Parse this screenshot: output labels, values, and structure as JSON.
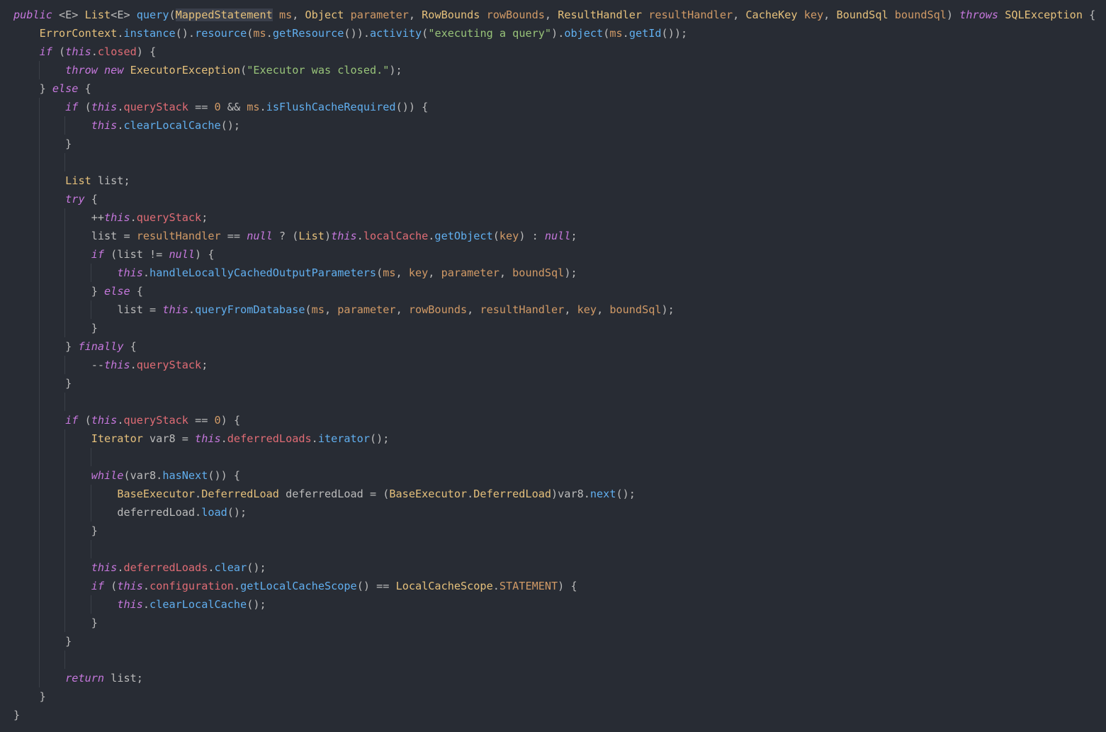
{
  "editor": {
    "language": "java",
    "theme_colors": {
      "background": "#282c34",
      "keyword": "#c678dd",
      "type": "#e5c07b",
      "function": "#61afef",
      "field": "#e06c75",
      "parameter": "#d19a66",
      "string": "#98c379",
      "number": "#d19a66",
      "plain": "#bbbbbb"
    },
    "lines": [
      {
        "indent": 0,
        "tokens": [
          [
            "kw",
            "public"
          ],
          [
            "p",
            " <E> "
          ],
          [
            "type",
            "List"
          ],
          [
            "p",
            "<E> "
          ],
          [
            "fn",
            "query"
          ],
          [
            "p",
            "("
          ],
          [
            "type_hl",
            "MappedStatement"
          ],
          [
            "p",
            " "
          ],
          [
            "param",
            "ms"
          ],
          [
            "p",
            ", "
          ],
          [
            "type",
            "Object"
          ],
          [
            "p",
            " "
          ],
          [
            "param",
            "parameter"
          ],
          [
            "p",
            ", "
          ],
          [
            "type",
            "RowBounds"
          ],
          [
            "p",
            " "
          ],
          [
            "param",
            "rowBounds"
          ],
          [
            "p",
            ", "
          ],
          [
            "type",
            "ResultHandler"
          ],
          [
            "p",
            " "
          ],
          [
            "param",
            "resultHandler"
          ],
          [
            "p",
            ", "
          ],
          [
            "type",
            "CacheKey"
          ],
          [
            "p",
            " "
          ],
          [
            "param",
            "key"
          ],
          [
            "p",
            ", "
          ],
          [
            "type",
            "BoundSql"
          ],
          [
            "p",
            " "
          ],
          [
            "param",
            "boundSql"
          ],
          [
            "p",
            ") "
          ],
          [
            "kw",
            "throws"
          ],
          [
            "p",
            " "
          ],
          [
            "type",
            "SQLException"
          ],
          [
            "p",
            " {"
          ]
        ]
      },
      {
        "indent": 1,
        "tokens": [
          [
            "type",
            "ErrorContext"
          ],
          [
            "p",
            "."
          ],
          [
            "fn",
            "instance"
          ],
          [
            "p",
            "()."
          ],
          [
            "fn",
            "resource"
          ],
          [
            "p",
            "("
          ],
          [
            "param",
            "ms"
          ],
          [
            "p",
            "."
          ],
          [
            "fn",
            "getResource"
          ],
          [
            "p",
            "())."
          ],
          [
            "fn",
            "activity"
          ],
          [
            "p",
            "("
          ],
          [
            "str",
            "\"executing a query\""
          ],
          [
            "p",
            ")."
          ],
          [
            "fn",
            "object"
          ],
          [
            "p",
            "("
          ],
          [
            "param",
            "ms"
          ],
          [
            "p",
            "."
          ],
          [
            "fn",
            "getId"
          ],
          [
            "p",
            "());"
          ]
        ]
      },
      {
        "indent": 1,
        "tokens": [
          [
            "kw",
            "if"
          ],
          [
            "p",
            " ("
          ],
          [
            "kw",
            "this"
          ],
          [
            "p",
            "."
          ],
          [
            "fld",
            "closed"
          ],
          [
            "p",
            ") {"
          ]
        ]
      },
      {
        "indent": 2,
        "tokens": [
          [
            "kw",
            "throw"
          ],
          [
            "p",
            " "
          ],
          [
            "kw",
            "new"
          ],
          [
            "p",
            " "
          ],
          [
            "type",
            "ExecutorException"
          ],
          [
            "p",
            "("
          ],
          [
            "str",
            "\"Executor was closed.\""
          ],
          [
            "p",
            ");"
          ]
        ]
      },
      {
        "indent": 1,
        "tokens": [
          [
            "p",
            "} "
          ],
          [
            "kw",
            "else"
          ],
          [
            "p",
            " {"
          ]
        ]
      },
      {
        "indent": 2,
        "tokens": [
          [
            "kw",
            "if"
          ],
          [
            "p",
            " ("
          ],
          [
            "kw",
            "this"
          ],
          [
            "p",
            "."
          ],
          [
            "fld",
            "queryStack"
          ],
          [
            "p",
            " == "
          ],
          [
            "num",
            "0"
          ],
          [
            "p",
            " && "
          ],
          [
            "param",
            "ms"
          ],
          [
            "p",
            "."
          ],
          [
            "fn",
            "isFlushCacheRequired"
          ],
          [
            "p",
            "()) {"
          ]
        ]
      },
      {
        "indent": 3,
        "tokens": [
          [
            "kw",
            "this"
          ],
          [
            "p",
            "."
          ],
          [
            "fn",
            "clearLocalCache"
          ],
          [
            "p",
            "();"
          ]
        ]
      },
      {
        "indent": 2,
        "tokens": [
          [
            "p",
            "}"
          ]
        ]
      },
      {
        "indent": 0,
        "tokens": []
      },
      {
        "indent": 2,
        "tokens": [
          [
            "type",
            "List"
          ],
          [
            "p",
            " list;"
          ]
        ]
      },
      {
        "indent": 2,
        "tokens": [
          [
            "kw",
            "try"
          ],
          [
            "p",
            " {"
          ]
        ]
      },
      {
        "indent": 3,
        "tokens": [
          [
            "p",
            "++"
          ],
          [
            "kw",
            "this"
          ],
          [
            "p",
            "."
          ],
          [
            "fld",
            "queryStack"
          ],
          [
            "p",
            ";"
          ]
        ]
      },
      {
        "indent": 3,
        "tokens": [
          [
            "p",
            "list = "
          ],
          [
            "param",
            "resultHandler"
          ],
          [
            "p",
            " == "
          ],
          [
            "kw",
            "null"
          ],
          [
            "p",
            " ? ("
          ],
          [
            "type",
            "List"
          ],
          [
            "p",
            ")"
          ],
          [
            "kw",
            "this"
          ],
          [
            "p",
            "."
          ],
          [
            "fld",
            "localCache"
          ],
          [
            "p",
            "."
          ],
          [
            "fn",
            "getObject"
          ],
          [
            "p",
            "("
          ],
          [
            "param",
            "key"
          ],
          [
            "p",
            ") : "
          ],
          [
            "kw",
            "null"
          ],
          [
            "p",
            ";"
          ]
        ]
      },
      {
        "indent": 3,
        "tokens": [
          [
            "kw",
            "if"
          ],
          [
            "p",
            " (list != "
          ],
          [
            "kw",
            "null"
          ],
          [
            "p",
            ") {"
          ]
        ]
      },
      {
        "indent": 4,
        "tokens": [
          [
            "kw",
            "this"
          ],
          [
            "p",
            "."
          ],
          [
            "fn",
            "handleLocallyCachedOutputParameters"
          ],
          [
            "p",
            "("
          ],
          [
            "param",
            "ms"
          ],
          [
            "p",
            ", "
          ],
          [
            "param",
            "key"
          ],
          [
            "p",
            ", "
          ],
          [
            "param",
            "parameter"
          ],
          [
            "p",
            ", "
          ],
          [
            "param",
            "boundSql"
          ],
          [
            "p",
            ");"
          ]
        ]
      },
      {
        "indent": 3,
        "tokens": [
          [
            "p",
            "} "
          ],
          [
            "kw",
            "else"
          ],
          [
            "p",
            " {"
          ]
        ]
      },
      {
        "indent": 4,
        "tokens": [
          [
            "p",
            "list = "
          ],
          [
            "kw",
            "this"
          ],
          [
            "p",
            "."
          ],
          [
            "fn",
            "queryFromDatabase"
          ],
          [
            "p",
            "("
          ],
          [
            "param",
            "ms"
          ],
          [
            "p",
            ", "
          ],
          [
            "param",
            "parameter"
          ],
          [
            "p",
            ", "
          ],
          [
            "param",
            "rowBounds"
          ],
          [
            "p",
            ", "
          ],
          [
            "param",
            "resultHandler"
          ],
          [
            "p",
            ", "
          ],
          [
            "param",
            "key"
          ],
          [
            "p",
            ", "
          ],
          [
            "param",
            "boundSql"
          ],
          [
            "p",
            ");"
          ]
        ]
      },
      {
        "indent": 3,
        "tokens": [
          [
            "p",
            "}"
          ]
        ]
      },
      {
        "indent": 2,
        "tokens": [
          [
            "p",
            "} "
          ],
          [
            "kw",
            "finally"
          ],
          [
            "p",
            " {"
          ]
        ]
      },
      {
        "indent": 3,
        "tokens": [
          [
            "p",
            "--"
          ],
          [
            "kw",
            "this"
          ],
          [
            "p",
            "."
          ],
          [
            "fld",
            "queryStack"
          ],
          [
            "p",
            ";"
          ]
        ]
      },
      {
        "indent": 2,
        "tokens": [
          [
            "p",
            "}"
          ]
        ]
      },
      {
        "indent": 0,
        "tokens": []
      },
      {
        "indent": 2,
        "tokens": [
          [
            "kw",
            "if"
          ],
          [
            "p",
            " ("
          ],
          [
            "kw",
            "this"
          ],
          [
            "p",
            "."
          ],
          [
            "fld",
            "queryStack"
          ],
          [
            "p",
            " == "
          ],
          [
            "num",
            "0"
          ],
          [
            "p",
            ") {"
          ]
        ]
      },
      {
        "indent": 3,
        "tokens": [
          [
            "type",
            "Iterator"
          ],
          [
            "p",
            " var8 = "
          ],
          [
            "kw",
            "this"
          ],
          [
            "p",
            "."
          ],
          [
            "fld",
            "deferredLoads"
          ],
          [
            "p",
            "."
          ],
          [
            "fn",
            "iterator"
          ],
          [
            "p",
            "();"
          ]
        ]
      },
      {
        "indent": 0,
        "tokens": []
      },
      {
        "indent": 3,
        "tokens": [
          [
            "kw",
            "while"
          ],
          [
            "p",
            "(var8."
          ],
          [
            "fn",
            "hasNext"
          ],
          [
            "p",
            "()) {"
          ]
        ]
      },
      {
        "indent": 4,
        "tokens": [
          [
            "type",
            "BaseExecutor"
          ],
          [
            "p",
            "."
          ],
          [
            "type",
            "DeferredLoad"
          ],
          [
            "p",
            " deferredLoad = ("
          ],
          [
            "type",
            "BaseExecutor"
          ],
          [
            "p",
            "."
          ],
          [
            "type",
            "DeferredLoad"
          ],
          [
            "p",
            ")var8."
          ],
          [
            "fn",
            "next"
          ],
          [
            "p",
            "();"
          ]
        ]
      },
      {
        "indent": 4,
        "tokens": [
          [
            "p",
            "deferredLoad."
          ],
          [
            "fn",
            "load"
          ],
          [
            "p",
            "();"
          ]
        ]
      },
      {
        "indent": 3,
        "tokens": [
          [
            "p",
            "}"
          ]
        ]
      },
      {
        "indent": 0,
        "tokens": []
      },
      {
        "indent": 3,
        "tokens": [
          [
            "kw",
            "this"
          ],
          [
            "p",
            "."
          ],
          [
            "fld",
            "deferredLoads"
          ],
          [
            "p",
            "."
          ],
          [
            "fn",
            "clear"
          ],
          [
            "p",
            "();"
          ]
        ]
      },
      {
        "indent": 3,
        "tokens": [
          [
            "kw",
            "if"
          ],
          [
            "p",
            " ("
          ],
          [
            "kw",
            "this"
          ],
          [
            "p",
            "."
          ],
          [
            "fld",
            "configuration"
          ],
          [
            "p",
            "."
          ],
          [
            "fn",
            "getLocalCacheScope"
          ],
          [
            "p",
            "() == "
          ],
          [
            "type",
            "LocalCacheScope"
          ],
          [
            "p",
            "."
          ],
          [
            "const",
            "STATEMENT"
          ],
          [
            "p",
            ") {"
          ]
        ]
      },
      {
        "indent": 4,
        "tokens": [
          [
            "kw",
            "this"
          ],
          [
            "p",
            "."
          ],
          [
            "fn",
            "clearLocalCache"
          ],
          [
            "p",
            "();"
          ]
        ]
      },
      {
        "indent": 3,
        "tokens": [
          [
            "p",
            "}"
          ]
        ]
      },
      {
        "indent": 2,
        "tokens": [
          [
            "p",
            "}"
          ]
        ]
      },
      {
        "indent": 0,
        "tokens": []
      },
      {
        "indent": 2,
        "tokens": [
          [
            "kw",
            "return"
          ],
          [
            "p",
            " list;"
          ]
        ]
      },
      {
        "indent": 1,
        "tokens": [
          [
            "p",
            "}"
          ]
        ]
      },
      {
        "indent": 0,
        "tokens": [
          [
            "p",
            "}"
          ]
        ]
      }
    ]
  }
}
